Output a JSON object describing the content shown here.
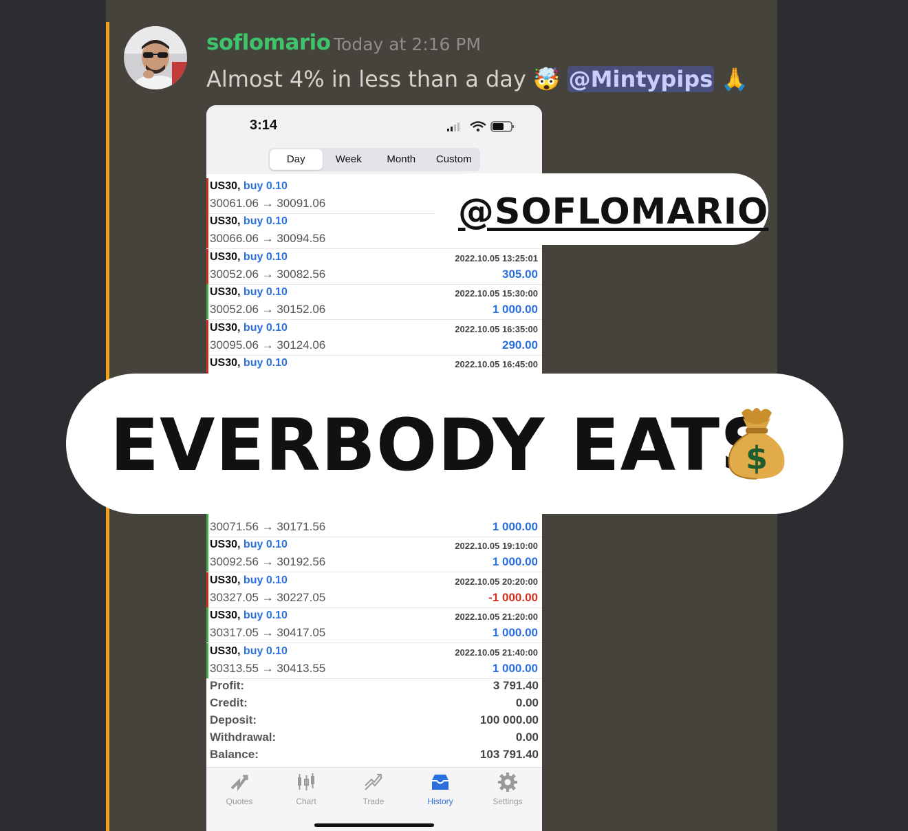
{
  "message": {
    "username": "soflomario",
    "timestamp": "Today at 2:16 PM",
    "text": "Almost 4% in less than a day",
    "emoji1": "🤯",
    "mention": "@Mintypips",
    "emoji2": "🙏"
  },
  "phone": {
    "clock": "3:14",
    "tabs": [
      "Day",
      "Week",
      "Month",
      "Custom"
    ],
    "active_tab": "Day"
  },
  "trades": [
    {
      "symbol": "US30,",
      "side": "buy 0.10",
      "prices": "30061.06 → 30091.06",
      "date": "",
      "pnl": "",
      "status": "loss"
    },
    {
      "symbol": "US30,",
      "side": "buy 0.10",
      "prices": "30066.06 → 30094.56",
      "date": "",
      "pnl": "",
      "status": "loss"
    },
    {
      "symbol": "US30,",
      "side": "buy 0.10",
      "prices": "30052.06 → 30082.56",
      "date": "2022.10.05 13:25:01",
      "pnl": "305.00",
      "status": "loss"
    },
    {
      "symbol": "US30,",
      "side": "buy 0.10",
      "prices": "30052.06 → 30152.06",
      "date": "2022.10.05 15:30:00",
      "pnl": "1 000.00",
      "status": "win"
    },
    {
      "symbol": "US30,",
      "side": "buy 0.10",
      "prices": "30095.06 → 30124.06",
      "date": "2022.10.05 16:35:00",
      "pnl": "290.00",
      "status": "loss"
    },
    {
      "symbol": "US30,",
      "side": "buy 0.10",
      "prices": "",
      "date": "2022.10.05 16:45:00",
      "pnl": "",
      "status": "loss"
    }
  ],
  "trades_lower": [
    {
      "symbol": "",
      "side": "",
      "prices": "30071.56 → 30171.56",
      "date": "",
      "pnl": "1 000.00",
      "status": "win"
    },
    {
      "symbol": "US30,",
      "side": "buy 0.10",
      "prices": "30092.56 → 30192.56",
      "date": "2022.10.05 19:10:00",
      "pnl": "1 000.00",
      "status": "win"
    },
    {
      "symbol": "US30,",
      "side": "buy 0.10",
      "prices": "30327.05 → 30227.05",
      "date": "2022.10.05 20:20:00",
      "pnl": "-1 000.00",
      "status": "loss"
    },
    {
      "symbol": "US30,",
      "side": "buy 0.10",
      "prices": "30317.05 → 30417.05",
      "date": "2022.10.05 21:20:00",
      "pnl": "1 000.00",
      "status": "win"
    },
    {
      "symbol": "US30,",
      "side": "buy 0.10",
      "prices": "30313.55 → 30413.55",
      "date": "2022.10.05 21:40:00",
      "pnl": "1 000.00",
      "status": "win"
    }
  ],
  "summary": [
    {
      "label": "Profit:",
      "value": "3 791.40"
    },
    {
      "label": "Credit:",
      "value": "0.00"
    },
    {
      "label": "Deposit:",
      "value": "100 000.00"
    },
    {
      "label": "Withdrawal:",
      "value": "0.00"
    },
    {
      "label": "Balance:",
      "value": "103 791.40"
    }
  ],
  "tabbar": [
    {
      "label": "Quotes",
      "icon": "quotes-icon",
      "active": false
    },
    {
      "label": "Chart",
      "icon": "chart-icon",
      "active": false
    },
    {
      "label": "Trade",
      "icon": "trade-icon",
      "active": false
    },
    {
      "label": "History",
      "icon": "history-icon",
      "active": true
    },
    {
      "label": "Settings",
      "icon": "gear-icon",
      "active": false
    }
  ],
  "stickers": {
    "handle": "@SOFLOMARIO",
    "headline": "EVERBODY EATS"
  },
  "colors": {
    "username": "#3ec56b",
    "accent_bar": "#f0a21a",
    "buy_blue": "#2a6fdb",
    "loss_red": "#d1301f",
    "win_green": "#3cb043"
  }
}
